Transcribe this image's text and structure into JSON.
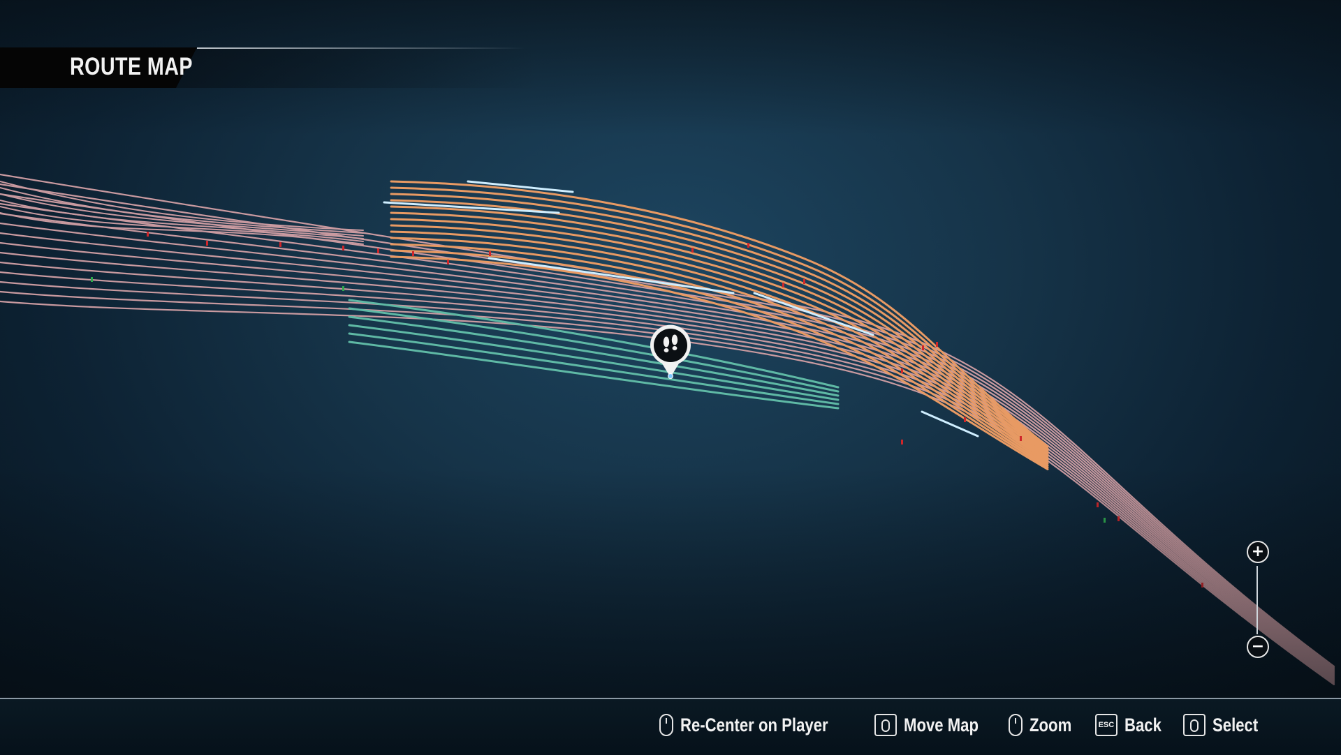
{
  "header": {
    "title": "ROUTE MAP"
  },
  "colors": {
    "background": "#163449",
    "track_default": "#c99aa0",
    "track_orange": "#e89a63",
    "track_teal": "#5fb9a5",
    "signal_red": "#d0262a",
    "signal_green": "#2fa84e",
    "occupied_blue": "#cfeeff"
  },
  "map": {
    "player_marker_icon": "footprints-icon"
  },
  "zoom": {
    "in_icon": "plus-icon",
    "out_icon": "minus-icon"
  },
  "controls": [
    {
      "icon": "mouse-middle-icon",
      "label": "Re-Center on Player"
    },
    {
      "icon": "mouse-drag-icon",
      "label": "Move Map"
    },
    {
      "icon": "mouse-scroll-icon",
      "label": "Zoom"
    },
    {
      "icon": "esc-key-icon",
      "key": "ESC",
      "label": "Back"
    },
    {
      "icon": "mouse-left-click-icon",
      "label": "Select"
    }
  ]
}
